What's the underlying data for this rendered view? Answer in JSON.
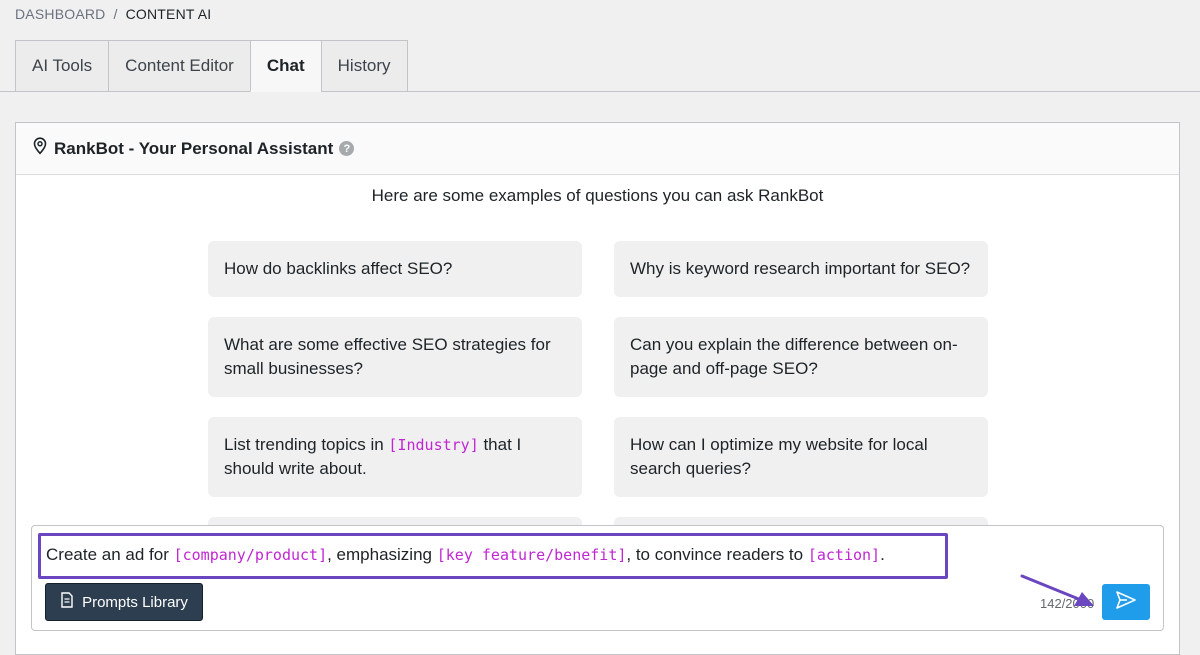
{
  "breadcrumb": {
    "root": "DASHBOARD",
    "separator": "/",
    "current": "CONTENT AI"
  },
  "tabs": [
    {
      "label": "AI Tools",
      "active": false
    },
    {
      "label": "Content Editor",
      "active": false
    },
    {
      "label": "Chat",
      "active": true
    },
    {
      "label": "History",
      "active": false
    }
  ],
  "panel": {
    "title": "RankBot - Your Personal Assistant",
    "help_icon": "?",
    "examples_heading": "Here are some examples of questions you can ask RankBot"
  },
  "examples": [
    {
      "text": "How do backlinks affect SEO?"
    },
    {
      "text": "Why is keyword research important for SEO?"
    },
    {
      "text": "What are some effective SEO strategies for small businesses?"
    },
    {
      "text": "Can you explain the difference between on-page and off-page SEO?"
    },
    {
      "pre": "List trending topics in ",
      "placeholder": "[Industry]",
      "post": " that I should write about."
    },
    {
      "text": "How can I optimize my website for local search queries?"
    }
  ],
  "composer": {
    "prompt": {
      "part1": "Create an ad for ",
      "ph1": "[company/product]",
      "part2": ", emphasizing ",
      "ph2": "[key feature/benefit]",
      "part3": ", to convince readers to ",
      "ph3": "[action]",
      "part4": "."
    },
    "prompts_library_label": "Prompts Library",
    "counter": "142/2000"
  },
  "colors": {
    "placeholder": "#c026d3",
    "highlight_border": "#6b46c1",
    "send_button": "#1f9cea",
    "prompts_button": "#2c3e50"
  },
  "icons": {
    "panel": "location-pin-icon",
    "prompts": "document-icon",
    "send": "send-icon"
  }
}
